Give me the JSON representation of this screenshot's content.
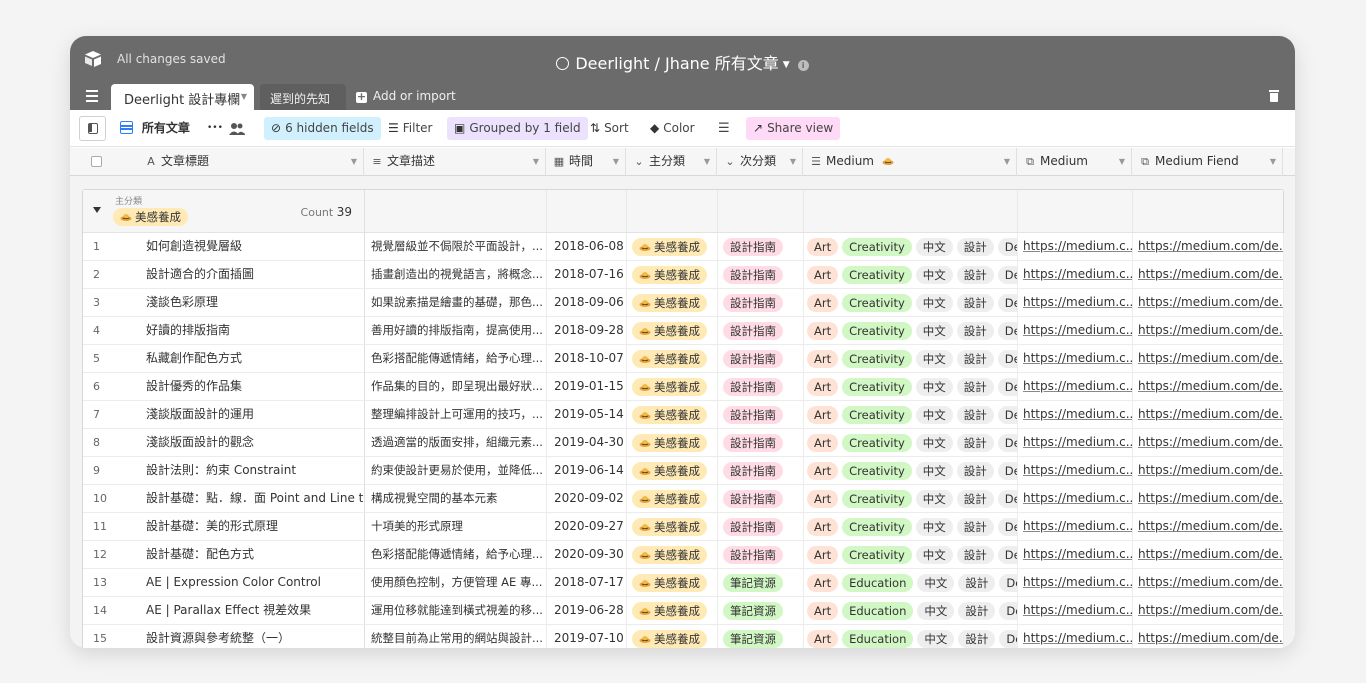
{
  "titlebar": {
    "save_status": "All changes saved",
    "title": "Deerlight / Jhane 所有文章",
    "info_glyph": "i"
  },
  "tabs": {
    "active": "Deerlight 設計專欄",
    "second": "遲到的先知",
    "add_import": "Add or import"
  },
  "toolbar": {
    "view_name": "所有文章",
    "more_glyph": "•••",
    "hidden_fields": "6 hidden fields",
    "filter": "Filter",
    "grouped": "Grouped by 1 field",
    "sort": "Sort",
    "color": "Color",
    "share": "Share view"
  },
  "columns": [
    {
      "label": "文章標題",
      "icon": "text-icon",
      "glyph": "A"
    },
    {
      "label": "文章描述",
      "icon": "long-text-icon",
      "glyph": "≡"
    },
    {
      "label": "時間",
      "icon": "calendar-icon",
      "glyph": "▦"
    },
    {
      "label": "主分類",
      "icon": "single-select-icon",
      "glyph": "⌄"
    },
    {
      "label": "次分類",
      "icon": "single-select-icon",
      "glyph": "⌄"
    },
    {
      "label": "Medium",
      "icon": "multi-select-icon",
      "glyph": "☰"
    },
    {
      "label": "Medium",
      "icon": "url-icon",
      "glyph": "⧉"
    },
    {
      "label": "Medium Fiend",
      "icon": "url-icon",
      "glyph": "⧉"
    }
  ],
  "group": {
    "field": "主分類",
    "value": "美感養成",
    "count_label": "Count",
    "count": "39"
  },
  "colors": {
    "titlebar": "#6b6b6b",
    "accent_blue": "#2d7ff9",
    "tag_main": "#fee2d5",
    "tag_sub_guide": "#ffdce5",
    "tag_sub_notes": "#d1f7c4"
  },
  "rows": [
    {
      "n": "1",
      "title": "如何創造視覺層級",
      "desc": "視覺層級並不侷限於平面設計，...",
      "date": "2018-06-08",
      "main": "美感養成",
      "sub": "設計指南",
      "sub_color": "pink",
      "tags": [
        "Art",
        "Creativity",
        "中文",
        "設計",
        "Desi"
      ],
      "url1": "https://medium.c...",
      "url2": "https://medium.com/de..."
    },
    {
      "n": "2",
      "title": "設計適合的介面插圖",
      "desc": "插畫創造出的視覺語言，將概念...",
      "date": "2018-07-16",
      "main": "美感養成",
      "sub": "設計指南",
      "sub_color": "pink",
      "tags": [
        "Art",
        "Creativity",
        "中文",
        "設計",
        "Desi"
      ],
      "url1": "https://medium.c...",
      "url2": "https://medium.com/de..."
    },
    {
      "n": "3",
      "title": "淺談色彩原理",
      "desc": "如果說素描是繪畫的基礎，那色...",
      "date": "2018-09-06",
      "main": "美感養成",
      "sub": "設計指南",
      "sub_color": "pink",
      "tags": [
        "Art",
        "Creativity",
        "中文",
        "設計",
        "Desi"
      ],
      "url1": "https://medium.c...",
      "url2": "https://medium.com/de..."
    },
    {
      "n": "4",
      "title": "好讀的排版指南",
      "desc": "善用好讀的排版指南，提高使用...",
      "date": "2018-09-28",
      "main": "美感養成",
      "sub": "設計指南",
      "sub_color": "pink",
      "tags": [
        "Art",
        "Creativity",
        "中文",
        "設計",
        "Desi"
      ],
      "url1": "https://medium.c...",
      "url2": "https://medium.com/de..."
    },
    {
      "n": "5",
      "title": "私藏創作配色方式",
      "desc": "色彩搭配能傳遞情緒，給予心理...",
      "date": "2018-10-07",
      "main": "美感養成",
      "sub": "設計指南",
      "sub_color": "pink",
      "tags": [
        "Art",
        "Creativity",
        "中文",
        "設計",
        "Desi"
      ],
      "url1": "https://medium.c...",
      "url2": "https://medium.com/de..."
    },
    {
      "n": "6",
      "title": "設計優秀的作品集",
      "desc": "作品集的目的，即呈現出最好狀...",
      "date": "2019-01-15",
      "main": "美感養成",
      "sub": "設計指南",
      "sub_color": "pink",
      "tags": [
        "Art",
        "Creativity",
        "中文",
        "設計",
        "Desi"
      ],
      "url1": "https://medium.c...",
      "url2": "https://medium.com/de..."
    },
    {
      "n": "7",
      "title": "淺談版面設計的運用",
      "desc": "整理編排設計上可運用的技巧，...",
      "date": "2019-05-14",
      "main": "美感養成",
      "sub": "設計指南",
      "sub_color": "pink",
      "tags": [
        "Art",
        "Creativity",
        "中文",
        "設計",
        "Desi"
      ],
      "url1": "https://medium.c...",
      "url2": "https://medium.com/de..."
    },
    {
      "n": "8",
      "title": "淺談版面設計的觀念",
      "desc": "透過適當的版面安排，組織元素...",
      "date": "2019-04-30",
      "main": "美感養成",
      "sub": "設計指南",
      "sub_color": "pink",
      "tags": [
        "Art",
        "Creativity",
        "中文",
        "設計",
        "Desi"
      ],
      "url1": "https://medium.c...",
      "url2": "https://medium.com/de..."
    },
    {
      "n": "9",
      "title": "設計法則：約束 Constraint",
      "desc": "約束使設計更易於使用，並降低...",
      "date": "2019-06-14",
      "main": "美感養成",
      "sub": "設計指南",
      "sub_color": "pink",
      "tags": [
        "Art",
        "Creativity",
        "中文",
        "設計",
        "Desi"
      ],
      "url1": "https://medium.c...",
      "url2": "https://medium.com/de..."
    },
    {
      "n": "10",
      "title": "設計基礎：點．線．面 Point and Line t...",
      "desc": "構成視覺空間的基本元素",
      "date": "2020-09-02",
      "main": "美感養成",
      "sub": "設計指南",
      "sub_color": "pink",
      "tags": [
        "Art",
        "Creativity",
        "中文",
        "設計",
        "Desi"
      ],
      "url1": "https://medium.c...",
      "url2": "https://medium.com/de..."
    },
    {
      "n": "11",
      "title": "設計基礎：美的形式原理",
      "desc": "十項美的形式原理",
      "date": "2020-09-27",
      "main": "美感養成",
      "sub": "設計指南",
      "sub_color": "pink",
      "tags": [
        "Art",
        "Creativity",
        "中文",
        "設計",
        "Desi"
      ],
      "url1": "https://medium.c...",
      "url2": "https://medium.com/de..."
    },
    {
      "n": "12",
      "title": "設計基礎：配色方式",
      "desc": "色彩搭配能傳遞情緒，給予心理...",
      "date": "2020-09-30",
      "main": "美感養成",
      "sub": "設計指南",
      "sub_color": "pink",
      "tags": [
        "Art",
        "Creativity",
        "中文",
        "設計",
        "Desi"
      ],
      "url1": "https://medium.c...",
      "url2": "https://medium.com/de..."
    },
    {
      "n": "13",
      "title": "AE | Expression Color Control",
      "desc": "使用顏色控制，方便管理 AE 專...",
      "date": "2018-07-17",
      "main": "美感養成",
      "sub": "筆記資源",
      "sub_color": "green",
      "tags": [
        "Art",
        "Education",
        "中文",
        "設計",
        "Des"
      ],
      "url1": "https://medium.c...",
      "url2": "https://medium.com/de..."
    },
    {
      "n": "14",
      "title": "AE | Parallax Effect 視差效果",
      "desc": "運用位移就能達到橫式視差的移...",
      "date": "2019-06-28",
      "main": "美感養成",
      "sub": "筆記資源",
      "sub_color": "green",
      "tags": [
        "Art",
        "Education",
        "中文",
        "設計",
        "Des"
      ],
      "url1": "https://medium.c...",
      "url2": "https://medium.com/de..."
    },
    {
      "n": "15",
      "title": "設計資源與參考統整（一）",
      "desc": "統整目前為止常用的網站與設計...",
      "date": "2019-07-10",
      "main": "美感養成",
      "sub": "筆記資源",
      "sub_color": "green",
      "tags": [
        "Art",
        "Education",
        "中文",
        "設計",
        "Des"
      ],
      "url1": "https://medium.c...",
      "url2": "https://medium.com/de..."
    }
  ]
}
